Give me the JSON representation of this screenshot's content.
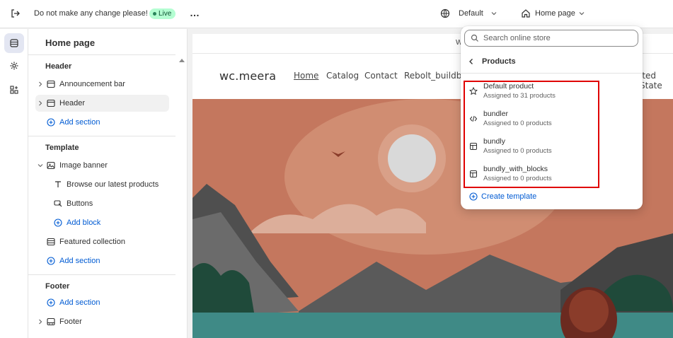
{
  "topbar": {
    "store_message": "Do not make any change please!",
    "live_label": "Live",
    "more_label": "…",
    "theme_selector": "Default",
    "page_selector": "Home page"
  },
  "sidebar": {
    "title": "Home page",
    "groups": {
      "header": {
        "title": "Header",
        "items": [
          "Announcement bar",
          "Header"
        ],
        "add_label": "Add section"
      },
      "template": {
        "title": "Template",
        "image_banner": "Image banner",
        "blocks": [
          "Browse our latest products",
          "Buttons"
        ],
        "add_block_label": "Add block",
        "featured": "Featured collection",
        "add_label": "Add section"
      },
      "footer": {
        "title": "Footer",
        "add_label": "Add section",
        "items": [
          "Footer"
        ]
      }
    }
  },
  "preview": {
    "brand": "wc.meera",
    "nav": [
      "Home",
      "Catalog",
      "Contact",
      "Rebolt_buildbox"
    ],
    "annbar_fragment": "W",
    "region_fragment": "ited State"
  },
  "dropdown": {
    "search_placeholder": "Search online store",
    "back_label": "Products",
    "templates": [
      {
        "name": "Default product",
        "assigned": "Assigned to 31 products",
        "icon": "star-icon"
      },
      {
        "name": "bundler",
        "assigned": "Assigned to 0 products",
        "icon": "code-icon"
      },
      {
        "name": "bundly",
        "assigned": "Assigned to 0 products",
        "icon": "layout-icon"
      },
      {
        "name": "bundly_with_blocks",
        "assigned": "Assigned to 0 products",
        "icon": "layout-icon"
      }
    ],
    "create_label": "Create template"
  },
  "colors": {
    "accent": "#005bd3",
    "live_bg": "#b4fed2",
    "highlight": "#e00000"
  }
}
